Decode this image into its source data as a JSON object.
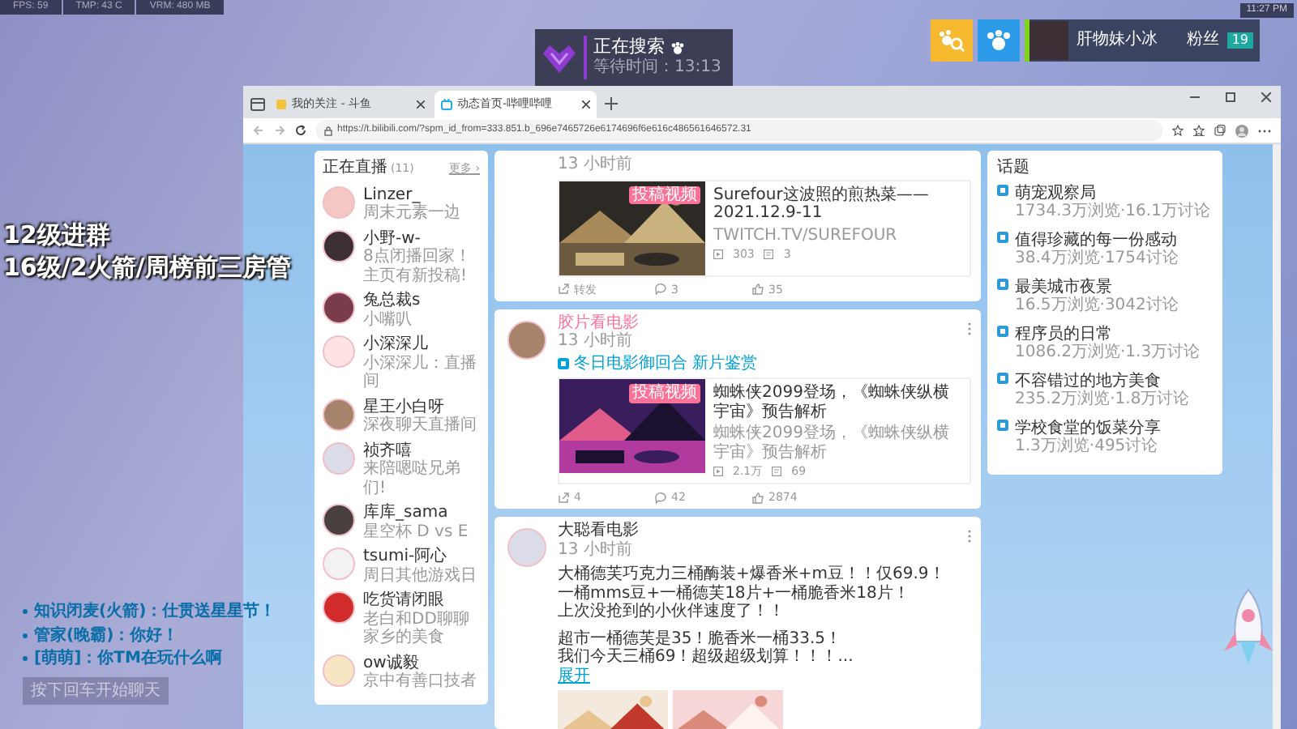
{
  "hud": {
    "fps": "FPS: 59",
    "temp": "TMP: 43 C",
    "vram": "VRM: 480 MB"
  },
  "clock": "11:27 PM",
  "search_widget": {
    "title": "正在搜索",
    "wait": "等待时间：13:13"
  },
  "streamer": {
    "name": "肝物妹小冰",
    "badge": "粉丝",
    "level": "19"
  },
  "overlay_notes": [
    "12级进群",
    "16级/2火箭/周榜前三房管"
  ],
  "chat": {
    "messages": [
      "知识闭麦(火箭)：仕贯送星星节！",
      "管家(晚霸)：你好！",
      "[萌萌]：你TM在玩什么啊"
    ],
    "enter_button": "按下回车开始聊天"
  },
  "browser": {
    "tabs": [
      {
        "title": "我的关注 - 斗鱼",
        "selected": false
      },
      {
        "title": "动态首页-哔哩哔哩",
        "selected": true
      }
    ],
    "url": "https://t.bilibili.com/?spm_id_from=333.851.b_696e7465726e6174696f6e616c486561646572.31"
  },
  "live_panel": {
    "title": "正在直播",
    "count": "(11)",
    "more": "更多 ›",
    "items": [
      {
        "name": "Linzer_",
        "subtitle": "周末元素一边"
      },
      {
        "name": "小野-w-",
        "subtitle": "8点闭播回家！主页有新投稿!"
      },
      {
        "name": "兔总裁s",
        "subtitle": "小嘴叭"
      },
      {
        "name": "小深深儿",
        "subtitle": "小深深儿：直播间"
      },
      {
        "name": "星王小白呀",
        "subtitle": "深夜聊天直播间"
      },
      {
        "name": "祯齐嘻",
        "subtitle": "来陪嗯哒兄弟们!"
      },
      {
        "name": "库库_sama",
        "subtitle": "星空杯 D vs E"
      },
      {
        "name": "tsumi-阿心",
        "subtitle": "周日其他游戏日"
      },
      {
        "name": "吃货请闭眼",
        "subtitle": "老白和DD聊聊家乡的美食"
      },
      {
        "name": "ow诚毅",
        "subtitle": "京中有善口技者"
      }
    ]
  },
  "feed": [
    {
      "kind": "video",
      "time": "13 小时前",
      "video": {
        "tag": "投稿视频",
        "title": "Surefour这波照的煎热菜——2021.12.9-11",
        "desc": "TWITCH.TV/SUREFOUR",
        "plays": "303",
        "danmaku": "3"
      },
      "actions": {
        "share": "转发",
        "comments": "3",
        "likes": "35"
      }
    },
    {
      "kind": "video",
      "author": "胶片看电影",
      "vip": true,
      "time": "13 小时前",
      "topic": "冬日电影御回合 新片鉴赏",
      "video": {
        "tag": "投稿视频",
        "title": "蜘蛛侠2099登场，《蜘蛛侠纵横宇宙》预告解析",
        "desc": "蜘蛛侠2099登场，《蜘蛛侠纵横宇宙》预告解析",
        "plays": "2.1万",
        "danmaku": "69"
      },
      "actions": {
        "share": "4",
        "comments": "42",
        "likes": "2874"
      }
    },
    {
      "kind": "text",
      "author": "大聪看电影",
      "vip": false,
      "time": "13 小时前",
      "lines": [
        "大桶德芙巧克力三桶酶装+爆香米+m豆！！仅69.9！",
        "一桶mms豆+一桶德芙18片+一桶脆香米18片！",
        "上次没抢到的小伙伴速度了！！",
        "超市一桶德芙是35！脆香米一桶33.5！",
        "我们今天三桶69！超级超级划算！！！..."
      ],
      "expand": "展开"
    }
  ],
  "topics": {
    "title": "话题",
    "items": [
      {
        "name": "萌宠观察局",
        "stats": "1734.3万浏览·16.1万讨论"
      },
      {
        "name": "值得珍藏的每一份感动",
        "stats": "38.4万浏览·1754讨论"
      },
      {
        "name": "最美城市夜景",
        "stats": "16.5万浏览·3042讨论"
      },
      {
        "name": "程序员的日常",
        "stats": "1086.2万浏览·1.3万讨论"
      },
      {
        "name": "不容错过的地方美食",
        "stats": "235.2万浏览·1.8万讨论"
      },
      {
        "name": "学校食堂的饭菜分享",
        "stats": "1.3万浏览·495讨论"
      }
    ]
  }
}
